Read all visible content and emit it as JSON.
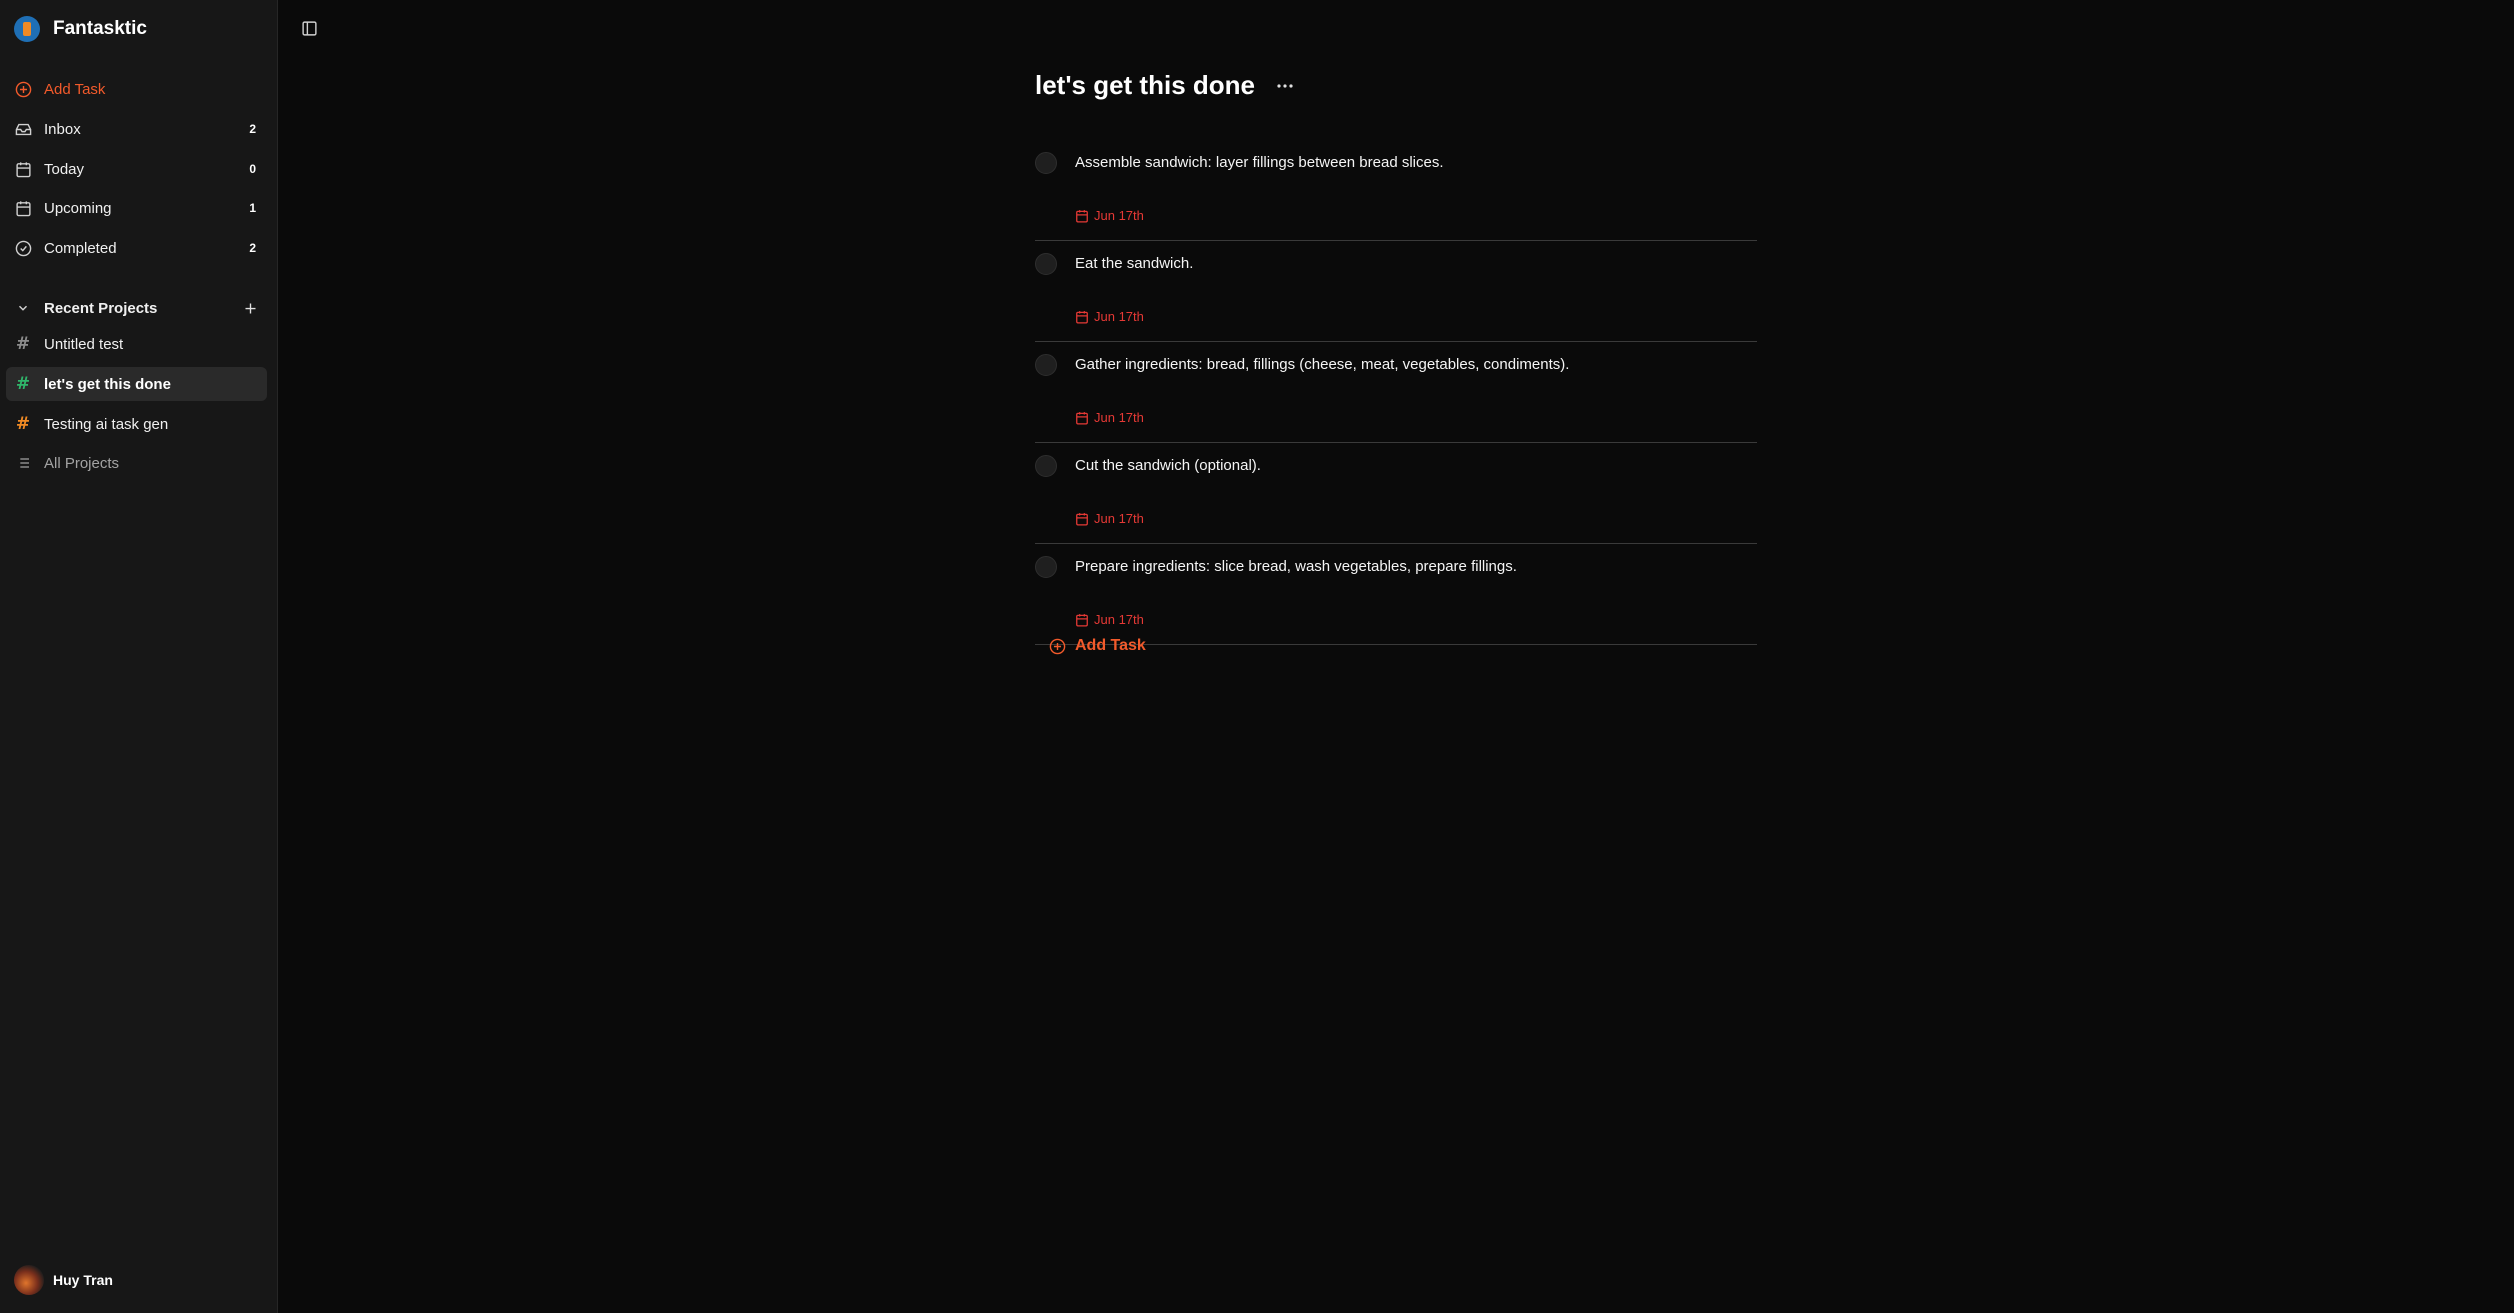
{
  "app": {
    "name": "Fantasktic"
  },
  "sidebar": {
    "add_task": "Add Task",
    "nav": [
      {
        "label": "Inbox",
        "count": "2",
        "icon": "inbox-icon"
      },
      {
        "label": "Today",
        "count": "0",
        "icon": "calendar-icon"
      },
      {
        "label": "Upcoming",
        "count": "1",
        "icon": "calendar-grid-icon"
      },
      {
        "label": "Completed",
        "count": "2",
        "icon": "check-circle-icon"
      }
    ],
    "recent_projects_label": "Recent Projects",
    "projects": [
      {
        "label": "Untitled test",
        "hash_color": "#8c8c8c"
      },
      {
        "label": "let's get this done",
        "hash_color": "#2fb56a"
      },
      {
        "label": "Testing ai task gen",
        "hash_color": "#f08a24"
      }
    ],
    "all_projects": "All Projects",
    "user": {
      "name": "Huy Tran"
    }
  },
  "main": {
    "title": "let's get this done",
    "tasks": [
      {
        "text": "Assemble sandwich: layer fillings between bread slices.",
        "due": "Jun 17th"
      },
      {
        "text": "Eat the sandwich.",
        "due": "Jun 17th"
      },
      {
        "text": "Gather ingredients: bread, fillings (cheese, meat, vegetables, condiments).",
        "due": "Jun 17th"
      },
      {
        "text": "Cut the sandwich (optional).",
        "due": "Jun 17th"
      },
      {
        "text": "Prepare ingredients: slice bread, wash vegetables, prepare fillings.",
        "due": "Jun 17th"
      }
    ],
    "add_task": "Add Task"
  },
  "colors": {
    "accent": "#f25a2b",
    "due_date": "#e53935",
    "sidebar_bg": "#171717",
    "main_bg": "#0a0a0a"
  }
}
